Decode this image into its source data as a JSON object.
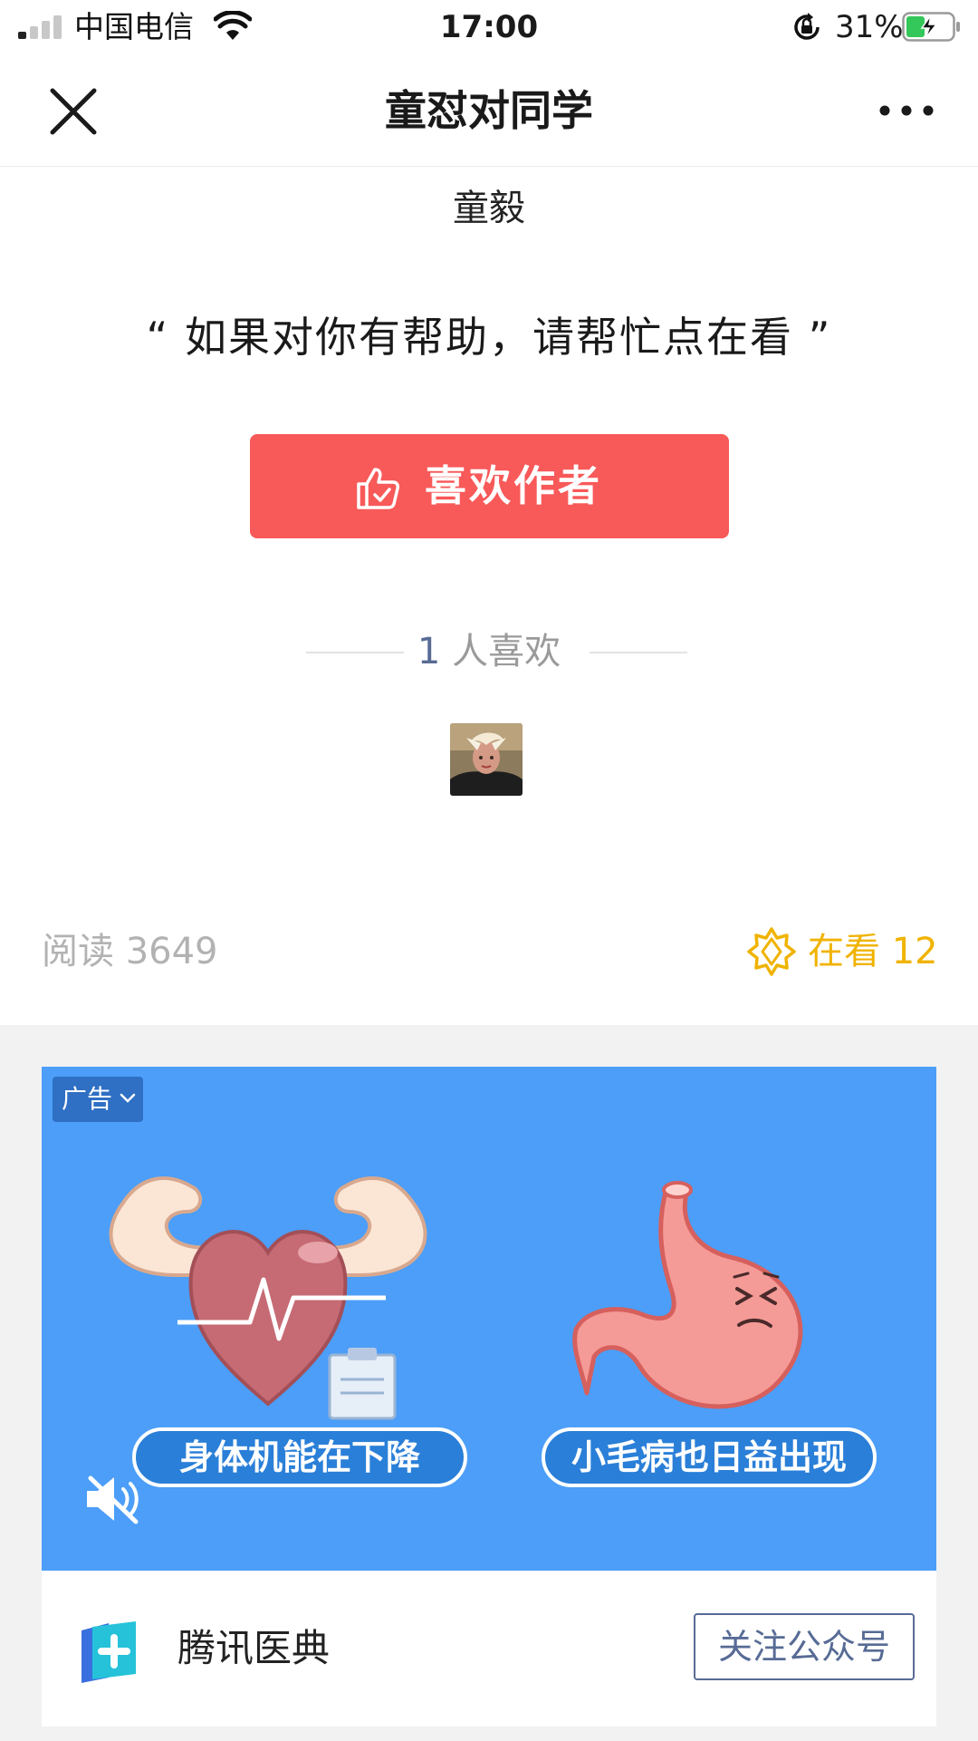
{
  "status_bar": {
    "carrier": "中国电信",
    "time": "17:00",
    "battery_percent": "31%",
    "icons": [
      "signal-icon",
      "wifi-icon",
      "rotation-lock-icon",
      "battery-charging-icon"
    ]
  },
  "nav": {
    "title": "童怼对同学",
    "close_icon": "close-icon",
    "more_icon": "more-icon"
  },
  "article_end": {
    "author": "童毅",
    "quote": "“ 如果对你有帮助，请帮忙点在看 ”",
    "like_button_label": "喜欢作者",
    "likes_count": "1",
    "likes_suffix": " 人喜欢"
  },
  "stats": {
    "read_label": "阅读 3649",
    "wow_label": "在看 12"
  },
  "ad": {
    "tag": "广告",
    "pill_left": "身体机能在下降",
    "pill_right": "小毛病也日益出现",
    "advertiser": "腾讯医典",
    "follow_label": "关注公众号"
  },
  "colors": {
    "like_button": "#f85959",
    "wow": "#f0b300",
    "link_blue": "#576b95",
    "ad_background": "#4c9ef8"
  }
}
